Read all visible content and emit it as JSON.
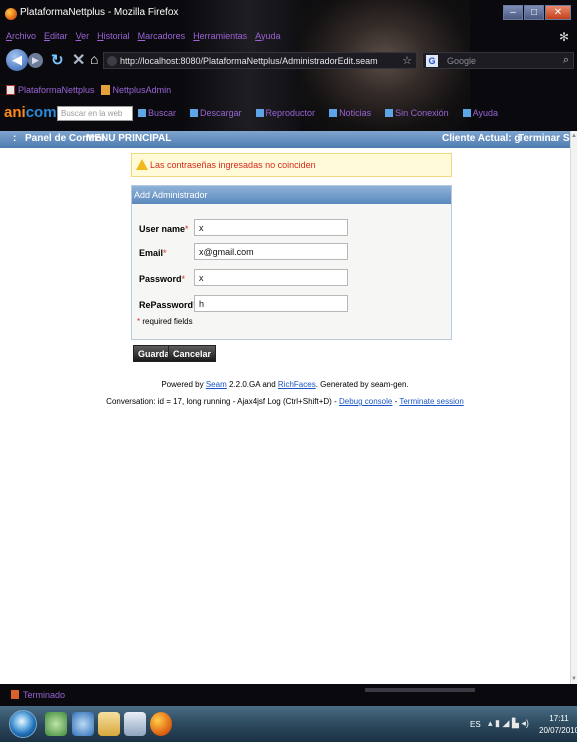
{
  "window": {
    "title": "PlataformaNettplus - Mozilla Firefox",
    "controls": [
      "–",
      "□",
      "✕"
    ]
  },
  "menu": [
    "Archivo",
    "Editar",
    "Ver",
    "Historial",
    "Marcadores",
    "Herramientas",
    "Ayuda"
  ],
  "address": {
    "url": "http://localhost:8080/PlataformaNettplus/AdministradorEdit.seam",
    "search_placeholder": "Google"
  },
  "bookmarks": [
    "PlataformaNettplus",
    "NettplusAdmin"
  ],
  "toolbar2": {
    "logo_main": "ani",
    "logo_accent": "com",
    "search_placeholder": "Buscar en la web",
    "items": [
      "Buscar",
      "Descargar",
      "Reproductor",
      "Noticias",
      "Sin Conexión",
      "Ayuda"
    ]
  },
  "header": {
    "panel_control": "Panel de Control",
    "menu_principal": "MENU PRINCIPAL",
    "cliente_actual": "Cliente Actual: g",
    "terminar_sesion": "Terminar Sesion"
  },
  "error": {
    "message": "Las contraseñas ingresadas no coinciden"
  },
  "form": {
    "title": "Add Administrador",
    "required_marker": "*",
    "fields": {
      "username": {
        "label": "User name",
        "value": "x"
      },
      "email": {
        "label": "Email",
        "value": "x@gmail.com"
      },
      "password": {
        "label": "Password",
        "value": "x"
      },
      "repassword": {
        "label": "RePassword",
        "value": "h"
      }
    },
    "required_note": "required fields",
    "save_label": "Guardar",
    "cancel_label": "Cancelar"
  },
  "footer": {
    "powered_prefix": "Powered by",
    "seam_link": "Seam",
    "powered_mid": "2.2.0.GA and",
    "richfaces_link": "RichFaces",
    "powered_suffix": ". Generated by seam-gen.",
    "conversation_text": "Conversation: id = 17, long running - Ajax4jsf Log (Ctrl+Shift+D) -",
    "debug_link": "Debug console",
    "separator": "-",
    "terminate_link": "Terminate session"
  },
  "status": {
    "text": "Terminado"
  },
  "taskbar": {
    "language": "ES",
    "time": "17:11",
    "date": "20/07/2010"
  }
}
